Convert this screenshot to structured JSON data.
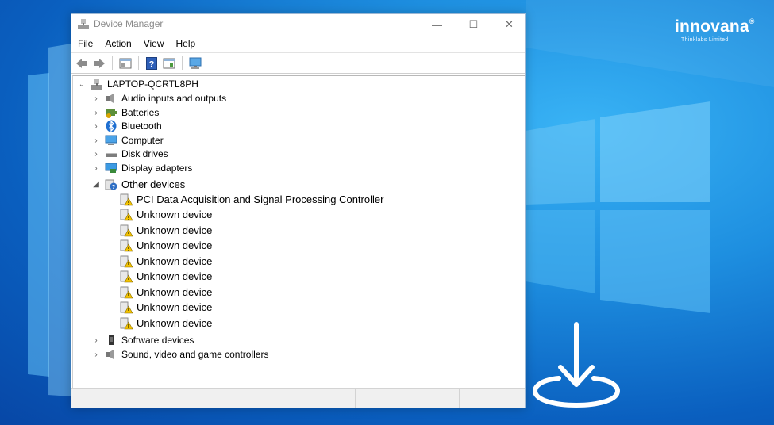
{
  "window": {
    "title": "Device Manager",
    "controls": {
      "minimize": "—",
      "maximize": "☐",
      "close": "✕"
    }
  },
  "menu": [
    "File",
    "Action",
    "View",
    "Help"
  ],
  "tree": {
    "root": "LAPTOP-QCRTL8PH",
    "categories_top": [
      {
        "label": "Audio inputs and outputs",
        "icon": "speaker-icon"
      },
      {
        "label": "Batteries",
        "icon": "battery-icon"
      },
      {
        "label": "Bluetooth",
        "icon": "bluetooth-icon"
      },
      {
        "label": "Computer",
        "icon": "computer-icon"
      },
      {
        "label": "Disk drives",
        "icon": "disk-drive-icon"
      },
      {
        "label": "Display adapters",
        "icon": "display-adapter-icon"
      }
    ],
    "other_devices": {
      "label": "Other devices",
      "children": [
        "PCI Data Acquisition and Signal Processing Controller",
        "Unknown device",
        "Unknown device",
        "Unknown device",
        "Unknown device",
        "Unknown device",
        "Unknown device",
        "Unknown device",
        "Unknown device"
      ]
    },
    "categories_bottom": [
      {
        "label": "Software devices",
        "icon": "software-device-icon"
      },
      {
        "label": "Sound, video and game controllers",
        "icon": "speaker-icon"
      }
    ]
  },
  "brand": {
    "name": "innovana",
    "registered": "®",
    "tagline": "Thinklabs Limited"
  },
  "colors": {
    "background": "#1e8fe0",
    "warning": "#f4c400",
    "window_border": "#9bb7d4"
  }
}
